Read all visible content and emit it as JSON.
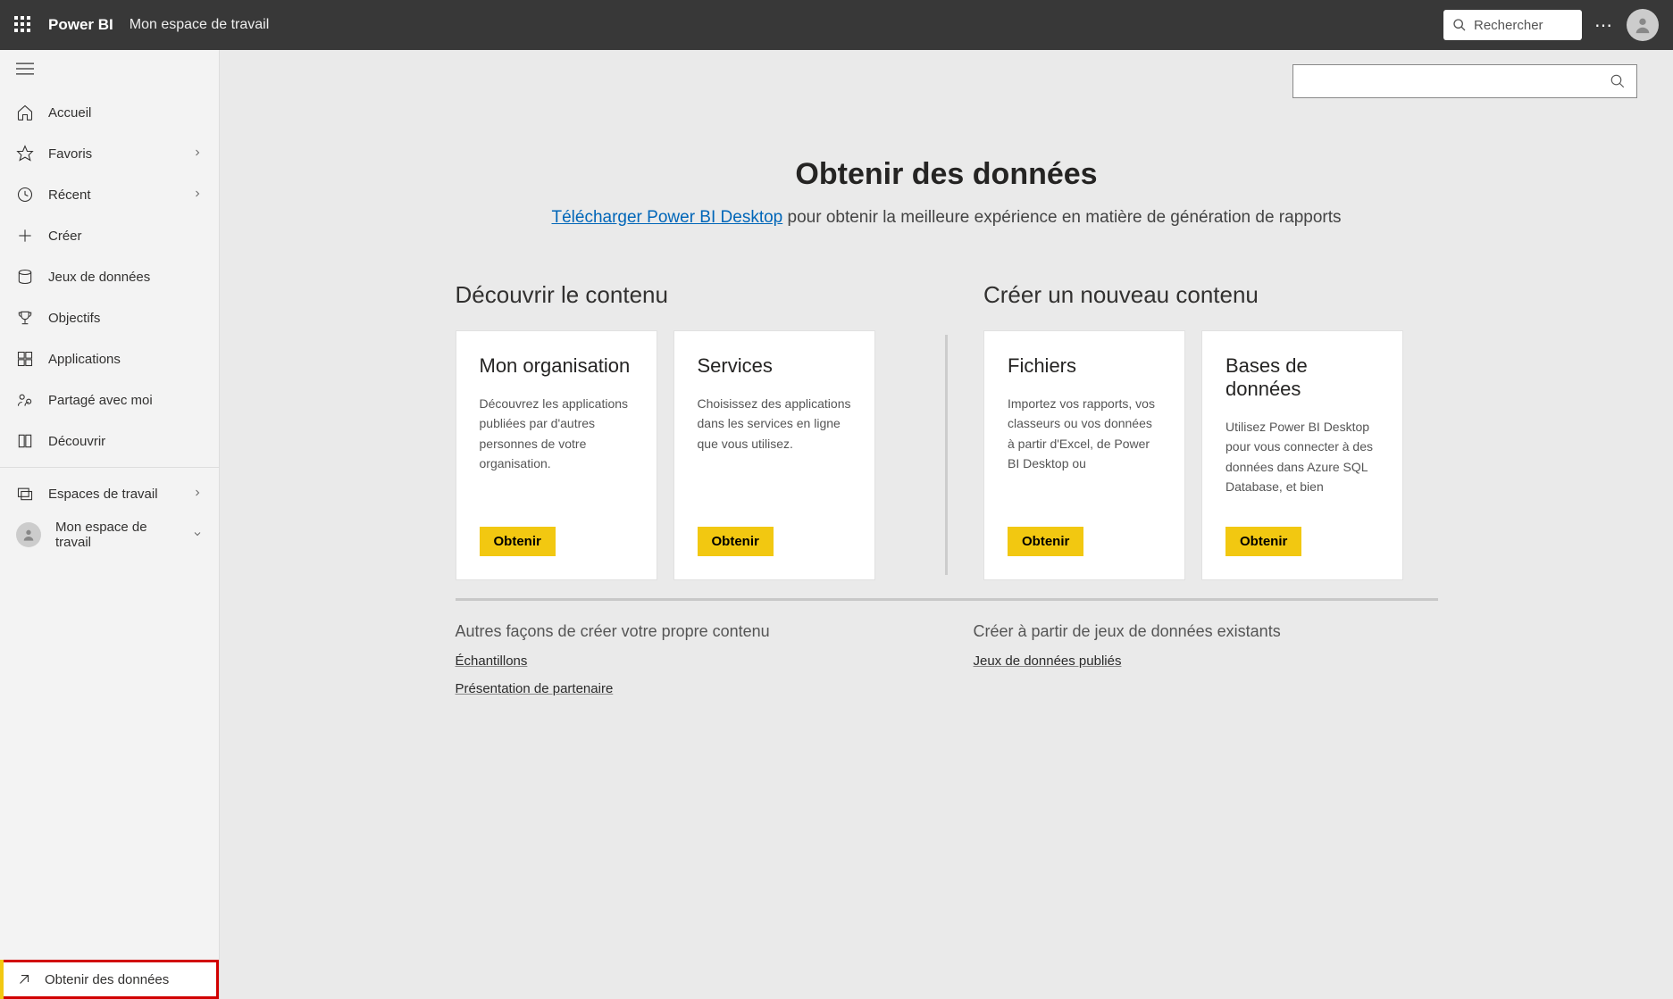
{
  "header": {
    "brand": "Power BI",
    "workspace": "Mon espace de travail",
    "search_placeholder": "Rechercher"
  },
  "sidebar": {
    "items": [
      {
        "label": "Accueil",
        "icon": "home",
        "chevron": false
      },
      {
        "label": "Favoris",
        "icon": "star",
        "chevron": true
      },
      {
        "label": "Récent",
        "icon": "clock",
        "chevron": true
      },
      {
        "label": "Créer",
        "icon": "plus",
        "chevron": false
      },
      {
        "label": "Jeux de données",
        "icon": "cylinder",
        "chevron": false
      },
      {
        "label": "Objectifs",
        "icon": "trophy",
        "chevron": false
      },
      {
        "label": "Applications",
        "icon": "apps",
        "chevron": false
      },
      {
        "label": "Partagé avec moi",
        "icon": "share",
        "chevron": false
      },
      {
        "label": "Découvrir",
        "icon": "book",
        "chevron": false
      }
    ],
    "workspaces_label": "Espaces de travail",
    "my_workspace_label": "Mon espace de travail",
    "get_data_label": "Obtenir des données"
  },
  "main": {
    "title": "Obtenir des données",
    "subtitle_link": "Télécharger Power BI Desktop",
    "subtitle_rest": " pour obtenir la meilleure expérience en matière de génération de rapports",
    "discover_title": "Découvrir le contenu",
    "create_title": "Créer un nouveau contenu",
    "cards_discover": [
      {
        "title": "Mon organisation",
        "desc": "Découvrez les applications publiées par d'autres personnes de votre organisation.",
        "button": "Obtenir"
      },
      {
        "title": "Services",
        "desc": "Choisissez des applications dans les services en ligne que vous utilisez.",
        "button": "Obtenir"
      }
    ],
    "cards_create": [
      {
        "title": "Fichiers",
        "desc": "Importez vos rapports, vos classeurs ou vos données à partir d'Excel, de Power BI Desktop ou",
        "button": "Obtenir"
      },
      {
        "title": "Bases de données",
        "desc": "Utilisez Power BI Desktop pour vous connecter à des données dans Azure SQL Database, et bien",
        "button": "Obtenir"
      }
    ],
    "bottom": {
      "left_heading": "Autres façons de créer votre propre contenu",
      "left_links": [
        "Échantillons",
        "Présentation de partenaire"
      ],
      "right_heading": "Créer à partir de jeux de données existants",
      "right_links": [
        "Jeux de données publiés"
      ]
    }
  }
}
